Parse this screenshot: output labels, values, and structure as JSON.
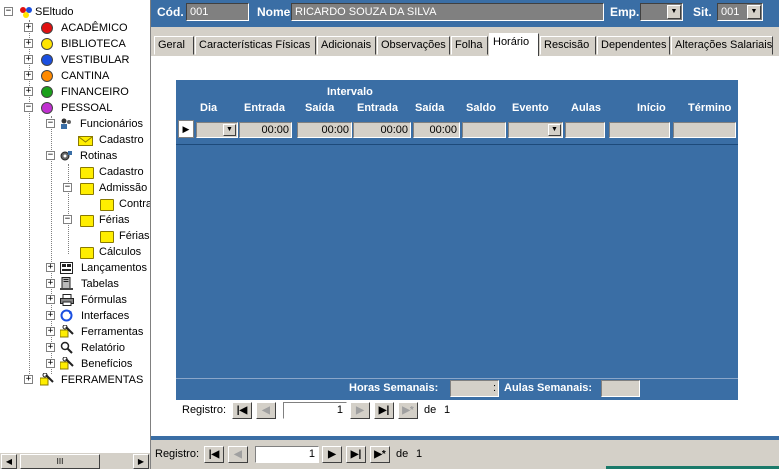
{
  "tree": {
    "root": "SEltudo",
    "modules": [
      {
        "label": "ACADÊMICO",
        "color": "#e01010"
      },
      {
        "label": "BIBLIOTECA",
        "color": "#ffe400"
      },
      {
        "label": "VESTIBULAR",
        "color": "#1a4fe0"
      },
      {
        "label": "CANTINA",
        "color": "#ff8a00"
      },
      {
        "label": "FINANCEIRO",
        "color": "#1aa01a"
      },
      {
        "label": "PESSOAL",
        "color": "#c030d0"
      }
    ],
    "pessoal": {
      "funcionarios": "Funcionários",
      "cadastro": "Cadastro",
      "rotinas": "Rotinas",
      "rotinas_cadastro": "Cadastro",
      "admissao": "Admissão",
      "contra": "Contra",
      "ferias": "Férias",
      "ferias_child": "Férias",
      "calculos": "Cálculos",
      "lancamentos": "Lançamentos",
      "tabelas": "Tabelas",
      "formulas": "Fórmulas",
      "interfaces": "Interfaces",
      "ferramentas": "Ferramentas",
      "relatorio": "Relatório",
      "beneficios": "Benefícios"
    },
    "ferramentas_root": "FERRAMENTAS",
    "scroll_thumb": "III"
  },
  "header": {
    "cod_label": "Cód.",
    "cod_value": "001",
    "nome_label": "Nome",
    "nome_value": "RICARDO SOUZA DA SILVA",
    "emp_label": "Emp.",
    "emp_value": "",
    "sit_label": "Sit.",
    "sit_value": "001"
  },
  "tabs": [
    "Geral",
    "Características Físicas",
    "Adicionais",
    "Observações",
    "Folha",
    "Horário",
    "Rescisão",
    "Dependentes",
    "Alterações Salariais"
  ],
  "active_tab": "Horário",
  "grid": {
    "intervalo_label": "Intervalo",
    "columns": [
      "Dia",
      "Entrada",
      "Saída",
      "Entrada",
      "Saída",
      "Saldo",
      "Evento",
      "Aulas",
      "Início",
      "Término"
    ],
    "row": {
      "dia": "",
      "entrada": "00:00",
      "saida": "00:00",
      "entrada2": "00:00",
      "saida2": "00:00",
      "saldo": "",
      "evento": "",
      "aulas": "",
      "inicio": "",
      "termino": ""
    },
    "horas_semanais_label": "Horas Semanais:",
    "horas_semanais_value": ":",
    "aulas_semanais_label": "Aulas Semanais:",
    "aulas_semanais_value": ""
  },
  "subform_nav": {
    "label": "Registro:",
    "current": "1",
    "of_label": "de",
    "total": "1"
  },
  "main_nav": {
    "label": "Registro:",
    "current": "1",
    "of_label": "de",
    "total": "1"
  },
  "colors": {
    "header_blue": "#3a6ea5",
    "grid_blue": "#3a6ea5",
    "window_gray": "#d4d0c8"
  }
}
